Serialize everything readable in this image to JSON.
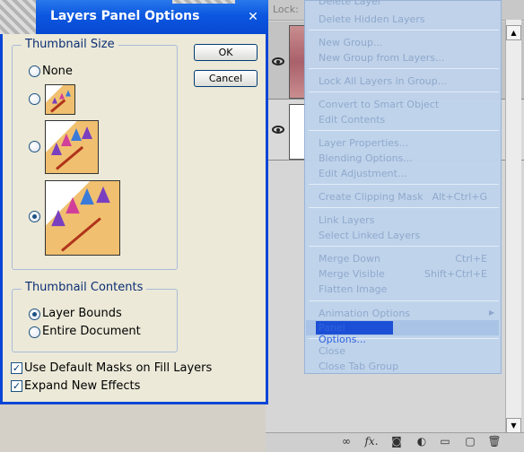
{
  "dialog": {
    "title": "Layers Panel Options",
    "close_glyph": "✕",
    "thumbnail_size": {
      "legend": "Thumbnail Size",
      "options": [
        {
          "label": "None",
          "selected": false
        },
        {
          "label": "",
          "size": "small",
          "selected": false
        },
        {
          "label": "",
          "size": "medium",
          "selected": false
        },
        {
          "label": "",
          "size": "large",
          "selected": true
        }
      ]
    },
    "thumbnail_contents": {
      "legend": "Thumbnail Contents",
      "options": [
        {
          "label": "Layer Bounds",
          "selected": true
        },
        {
          "label": "Entire Document",
          "selected": false
        }
      ]
    },
    "checkboxes": [
      {
        "label": "Use Default Masks on Fill Layers",
        "checked": true
      },
      {
        "label": "Expand New Effects",
        "checked": true
      }
    ],
    "buttons": {
      "ok": "OK",
      "cancel": "Cancel"
    }
  },
  "layers_panel": {
    "lock_label": "Lock:",
    "bottom_icons": [
      "link-icon",
      "fx-icon",
      "mask-icon",
      "adjustment-icon",
      "folder-icon",
      "new-layer-icon",
      "trash-icon"
    ],
    "bottom_glyphs": {
      "link": "∞",
      "fx": "fx.",
      "mask": "◙",
      "adjustment": "◐",
      "folder": "▭",
      "new_layer": "▢",
      "trash": "🗑"
    }
  },
  "context_menu": {
    "items": [
      {
        "label": "Delete Layer",
        "shortcut": ""
      },
      {
        "label": "Delete Hidden Layers",
        "shortcut": ""
      },
      {
        "label": "New Group...",
        "shortcut": ""
      },
      {
        "label": "New Group from Layers...",
        "shortcut": ""
      },
      {
        "label": "Lock All Layers in Group...",
        "shortcut": ""
      },
      {
        "label": "Convert to Smart Object",
        "shortcut": ""
      },
      {
        "label": "Edit Contents",
        "shortcut": ""
      },
      {
        "label": "Layer Properties...",
        "shortcut": ""
      },
      {
        "label": "Blending Options...",
        "shortcut": ""
      },
      {
        "label": "Edit Adjustment...",
        "shortcut": ""
      },
      {
        "label": "Create Clipping Mask",
        "shortcut": "Alt+Ctrl+G"
      },
      {
        "label": "Link Layers",
        "shortcut": ""
      },
      {
        "label": "Select Linked Layers",
        "shortcut": ""
      },
      {
        "label": "Merge Down",
        "shortcut": "Ctrl+E"
      },
      {
        "label": "Merge Visible",
        "shortcut": "Shift+Ctrl+E"
      },
      {
        "label": "Flatten Image",
        "shortcut": ""
      },
      {
        "label": "Animation Options",
        "shortcut": ""
      },
      {
        "label": "Panel Options...",
        "shortcut": ""
      },
      {
        "label": "Close",
        "shortcut": ""
      },
      {
        "label": "Close Tab Group",
        "shortcut": ""
      }
    ]
  },
  "colors": {
    "title_bar": "#0c57e0",
    "menu_bg": "#bfd3ec",
    "menu_text_disabled": "#8ea8cc",
    "highlight": "#1c4fd6"
  }
}
